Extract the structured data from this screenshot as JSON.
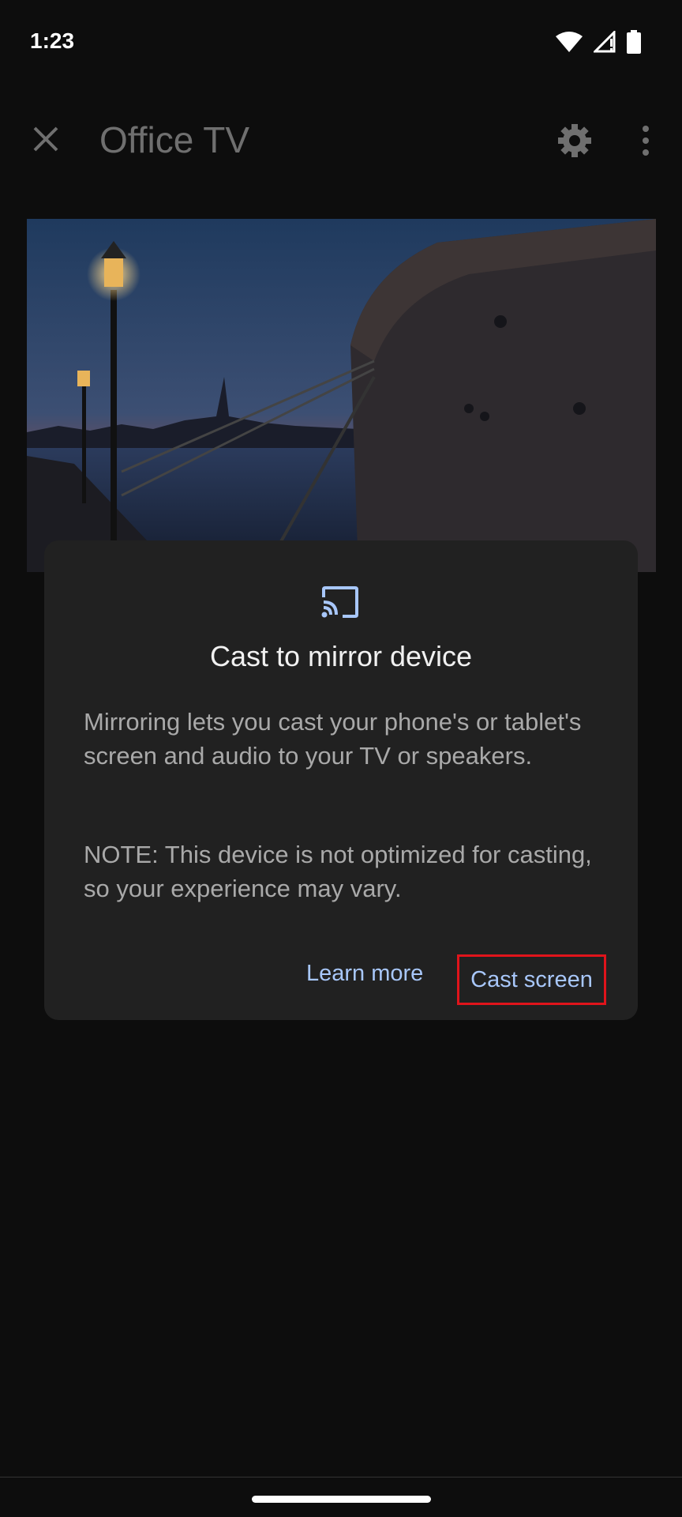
{
  "status_bar": {
    "time": "1:23",
    "icons": [
      "wifi-icon",
      "signal-icon",
      "battery-icon"
    ]
  },
  "app_bar": {
    "title": "Office TV",
    "close_icon": "close-icon",
    "settings_icon": "gear-icon",
    "more_icon": "more-vert-icon"
  },
  "hero_image": {
    "description_icon": "harbor-photo"
  },
  "dialog": {
    "icon": "cast-icon",
    "title": "Cast to mirror device",
    "body_1": "Mirroring lets you cast your phone's or tablet's screen and audio to your TV or speakers.",
    "body_2": "NOTE: This device is not optimized for casting, so your experience may vary.",
    "learn_more_label": "Learn more",
    "cast_screen_label": "Cast screen"
  },
  "colors": {
    "background": "#0d0d0d",
    "dialog": "#212121",
    "accent": "#a8c7fa",
    "highlight_border": "#e0141b"
  }
}
